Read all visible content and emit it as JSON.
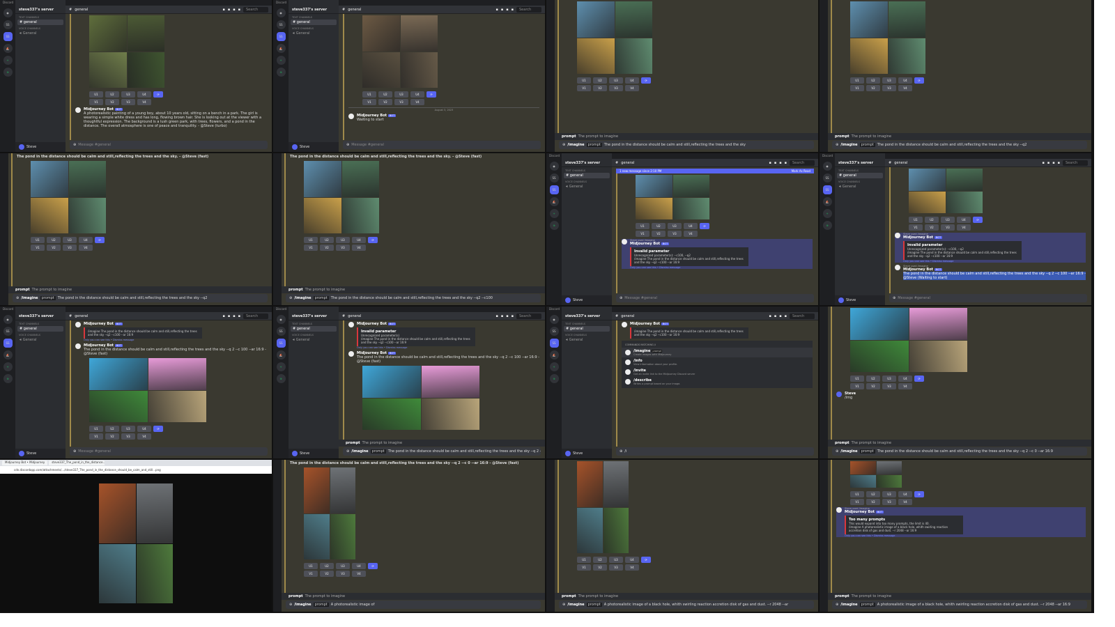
{
  "common": {
    "app_title": "Discord",
    "server_name": "steve337's server",
    "text_channels": "TEXT CHANNELS",
    "voice_channels": "VOICE CHANNELS",
    "channel": "general",
    "voice_channel": "General",
    "user": "Steve",
    "search": "Search",
    "message_placeholder": "Message #general",
    "bot_name": "Midjourney Bot",
    "bot_tag": "BOT",
    "buttons": [
      "U1",
      "U2",
      "U3",
      "U4",
      "V1",
      "V2",
      "V3",
      "V4"
    ],
    "refresh_icon": "refresh-icon",
    "hint_label": "prompt",
    "hint_desc": "The prompt to imagine",
    "accent": "#5865f2"
  },
  "image_sets": {
    "couple": [
      "#5f6e3c",
      "#4c5a35",
      "#6f7d4a",
      "#3f5530"
    ],
    "girls": [
      "#6d5a44",
      "#7b6a55",
      "#5a5040",
      "#665a48"
    ],
    "pond": [
      "#5e8fae",
      "#4a6f55",
      "#c9a04a",
      "#5f8c70"
    ],
    "colorful": [
      "#3fa7d9",
      "#e79bd8",
      "#3f8a3a",
      "#b9a57a"
    ],
    "dark": [
      "#a6532a",
      "#6e7276",
      "#4f7d8a",
      "#4e7a3c"
    ]
  },
  "tiles": [
    {
      "kind": "full",
      "items": [
        {
          "type": "images",
          "set": "couple"
        },
        {
          "type": "buttons"
        },
        {
          "type": "msg",
          "text": "A photorealistic painting of a young boy, about 10 years old, sitting on a bench in a park. The girl is wearing a simple white dress and has long, flowing brown hair. She is looking out at the viewer with a thoughtful expression. The background is a lush green park, with trees, flowers, and a pond in the distance. The overall atmosphere is one of peace and tranquility. - @Steve (turbo)"
        }
      ],
      "input": {
        "placeholder": true
      }
    },
    {
      "kind": "full",
      "items": [
        {
          "type": "images",
          "set": "girls"
        },
        {
          "type": "buttons"
        },
        {
          "type": "divider",
          "text": "August 3, 2023"
        },
        {
          "type": "msg",
          "text": "Waiting to start"
        }
      ],
      "input": {
        "placeholder": true
      }
    },
    {
      "kind": "chat",
      "items": [
        {
          "type": "images",
          "set": "pond"
        },
        {
          "type": "buttons"
        }
      ],
      "hint": true,
      "input": {
        "cmd": "/imagine",
        "opt": "prompt",
        "value": "The pond in the distance should be calm and still,reflecting the trees and the sky"
      }
    },
    {
      "kind": "chat",
      "items": [
        {
          "type": "images",
          "set": "pond"
        },
        {
          "type": "buttons"
        }
      ],
      "hint": true,
      "input": {
        "cmd": "/imagine",
        "opt": "prompt",
        "value": "The pond in the distance should be calm and still,reflecting the trees and the sky --q2"
      }
    },
    {
      "kind": "chat",
      "top": "The pond in the distance should be calm and still,reflecting the trees and the sky. - @Steve (fast)",
      "items": [
        {
          "type": "images",
          "set": "pond"
        },
        {
          "type": "buttons"
        }
      ],
      "hint": true,
      "input": {
        "cmd": "/imagine",
        "opt": "prompt",
        "value": "The pond in the distance should be calm and still,reflecting the trees and the sky --q2"
      }
    },
    {
      "kind": "chat",
      "top": "The pond in the distance should be calm and still,reflecting the trees and the sky. - @Steve (fast)",
      "items": [
        {
          "type": "images",
          "set": "pond"
        },
        {
          "type": "buttons"
        }
      ],
      "hint": true,
      "input": {
        "cmd": "/imagine",
        "opt": "prompt",
        "value": "The pond in the distance should be calm and still,reflecting the trees and the sky --q2 --c100"
      }
    },
    {
      "kind": "full",
      "newbar": {
        "text": "1 new message since 2:10 PM",
        "action": "Mark As Read"
      },
      "items": [
        {
          "type": "images",
          "set": "pond",
          "small": true
        },
        {
          "type": "buttons"
        },
        {
          "type": "msg",
          "hl": true,
          "used": "Steve used /imagine",
          "embed": {
            "title": "Invalid parameter",
            "lines": [
              "Unrecognized parameter(s): --c100, --q2",
              "/imagine The pond in the distance should be calm and still,reflecting the trees and the sky --q2 --c100 --ar 16:9"
            ]
          },
          "foot": "Only you can see this • Dismiss message"
        }
      ],
      "input": {
        "placeholder": true
      }
    },
    {
      "kind": "full",
      "items": [
        {
          "type": "images",
          "set": "pond",
          "small": true
        },
        {
          "type": "buttons"
        },
        {
          "type": "msg",
          "hl": true,
          "used": "Steve used /imagine",
          "embed": {
            "title": "Invalid parameter",
            "lines": [
              "Unrecognized parameter(s): --c100, --q2",
              "/imagine The pond in the distance should be calm and still,reflecting the trees and the sky --q2 --c100 --ar 16:9"
            ]
          },
          "foot": "Only you can see this • Dismiss message"
        },
        {
          "type": "msg",
          "used": "Steve used /imagine",
          "text": "The pond in the distance should be calm and still,reflecting the trees and the sky --q 2 --c 100 --ar 16:9 - @Steve (Waiting to start)",
          "selected": true
        }
      ],
      "input": {
        "placeholder": true
      }
    },
    {
      "kind": "full",
      "items": [
        {
          "type": "msg",
          "embed": {
            "title": "",
            "lines": [
              "/imagine The pond in the distance should be calm and still,reflecting the trees and the sky --q2 --c100 --ar 16:9"
            ]
          },
          "foot": "Only you can see this • Dismiss message"
        },
        {
          "type": "msg",
          "text": "The pond in the distance should be calm and still,reflecting the trees and the sky --q 2 --c 100 --ar 16:9 - @Steve (fast)"
        },
        {
          "type": "images",
          "set": "colorful",
          "wide": true
        },
        {
          "type": "buttons"
        }
      ],
      "input": {
        "placeholder": true
      }
    },
    {
      "kind": "full",
      "items": [
        {
          "type": "msg",
          "embed": {
            "title": "Invalid parameter",
            "lines": [
              "Unrecognized parameter(s)",
              "/imagine The pond in the distance should be calm and still,reflecting the trees and the sky --q2 --c100 --ar 16:9"
            ]
          },
          "foot": "Only you can see this • Dismiss message"
        },
        {
          "type": "msg",
          "text": "The pond in the distance should be calm and still,reflecting the trees and the sky --q 2 --c 100 --ar 16:9 - @Steve (fast)"
        },
        {
          "type": "images",
          "set": "colorful",
          "wide": true
        }
      ],
      "hint": true,
      "input": {
        "cmd": "/imagine",
        "opt": "prompt",
        "value": "The pond in the distance should be calm and still,reflecting the trees and the sky --q 2 --c 0 --ar 16:9"
      }
    },
    {
      "kind": "full",
      "items": [
        {
          "type": "msg",
          "embed": {
            "title": "",
            "lines": [
              "/imagine The pond in the distance should be calm and still,reflecting the trees and the sky --q2 --c100 --ar 16:9"
            ]
          }
        },
        {
          "type": "commands",
          "title": "COMMANDS MATCHING /i",
          "list": [
            {
              "name": "/imagine",
              "opt": "prompt",
              "desc": "Create images with Midjourney"
            },
            {
              "name": "/info",
              "desc": "View information about your profile."
            },
            {
              "name": "/invite",
              "desc": "Get an invite link to the Midjourney Discord server"
            },
            {
              "name": "/describe",
              "desc": "Writes a prompt based on your image."
            }
          ]
        }
      ],
      "input": {
        "cmd": "",
        "opt": "",
        "value": "/i"
      }
    },
    {
      "kind": "chat",
      "items": [
        {
          "type": "images",
          "set": "colorful",
          "wide": true
        },
        {
          "type": "buttons"
        },
        {
          "type": "msg",
          "user": true,
          "author": "Steve",
          "text": "/img"
        }
      ],
      "hint": true,
      "input": {
        "cmd": "/imagine",
        "opt": "prompt",
        "value": "The pond in the distance should be calm and still,reflecting the trees and the sky --q 2 --c 0 --ar 16:9"
      }
    },
    {
      "kind": "browser",
      "tabs": [
        "Midjourney Bot • Midjourney",
        "steve337_The_pond_in_the_distance..."
      ],
      "url": "cdn.discordapp.com/attachments/.../steve337_The_pond_in_the_distance_should_be_calm_and_still...png",
      "set": "dark"
    },
    {
      "kind": "chat",
      "top": "The pond in the distance should be calm and still,reflecting the trees and the sky --q 2 --c 0 --ar 16:9 - @Steve (fast)",
      "items": [
        {
          "type": "images",
          "set": "dark",
          "tall": true
        },
        {
          "type": "buttons"
        }
      ],
      "hint": true,
      "input": {
        "cmd": "/imagine",
        "opt": "prompt",
        "value": "A photorealistic image of"
      }
    },
    {
      "kind": "chat",
      "items": [
        {
          "type": "images",
          "set": "dark",
          "tall": true
        },
        {
          "type": "buttons"
        }
      ],
      "hint": true,
      "input": {
        "cmd": "/imagine",
        "opt": "prompt",
        "value": "A photorealistic image of a black hole, whith swirling reaction accretion disk of gas and dust. --r 2048 --ar"
      }
    },
    {
      "kind": "chat",
      "items": [
        {
          "type": "images",
          "set": "dark",
          "tiny": true
        },
        {
          "type": "buttons"
        },
        {
          "type": "msg",
          "hl": true,
          "used": "Steve used /imagine",
          "embed": {
            "title": "Too many prompts",
            "lines": [
              "This would expand into too many prompts, the limit is 40.",
              "/imagine A photorealistic image of a black hole, whith swirling reaction accretion disk of gas and dust. --r 2048 --ar 16:9"
            ]
          },
          "foot": "Only you can see this • Dismiss message"
        }
      ],
      "hint": true,
      "input": {
        "cmd": "/imagine",
        "opt": "prompt",
        "value": "A photorealistic image of a black hole, whith swirling reaction accretion disk of gas and dust. --r 2048 --ar 16:9"
      }
    }
  ]
}
